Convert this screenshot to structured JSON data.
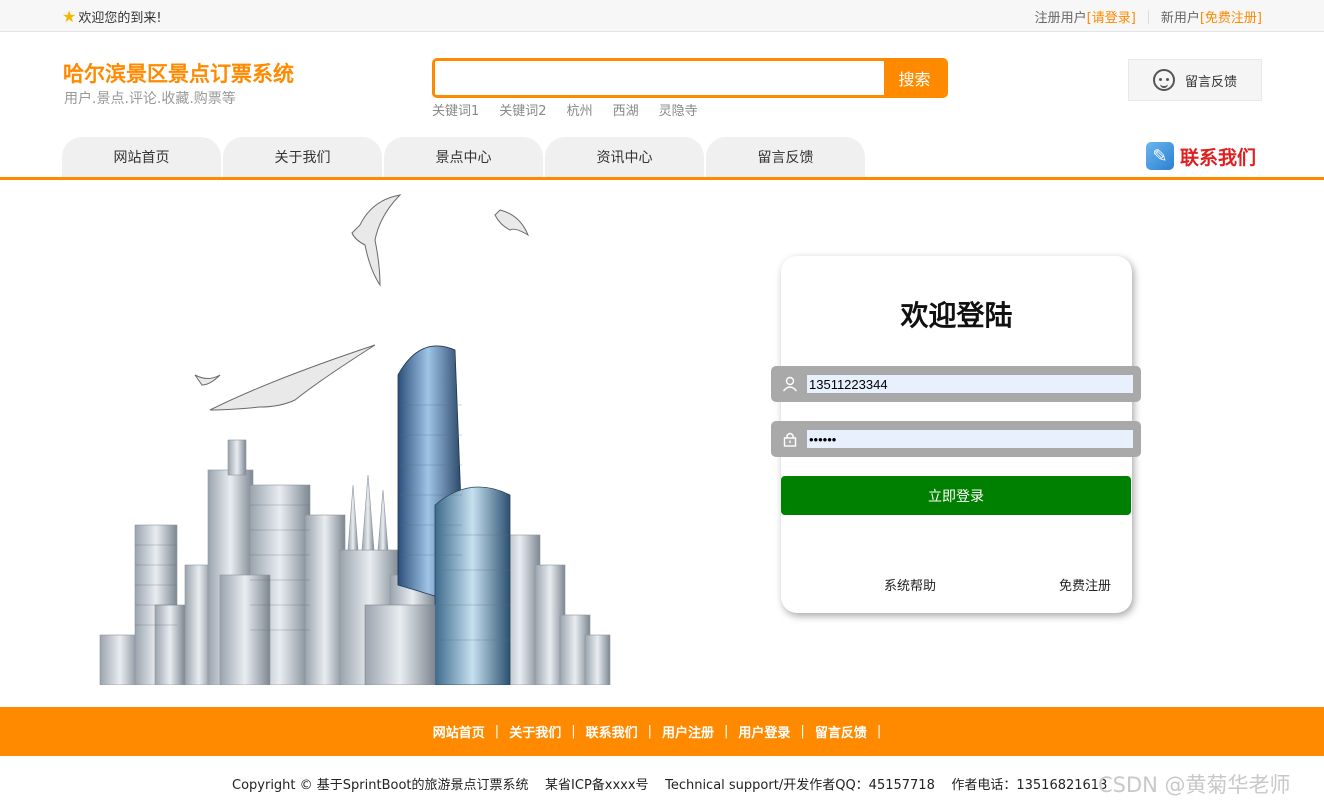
{
  "topbar": {
    "welcome": "欢迎您的到来!",
    "register_prefix": "注册用户",
    "login_link": "[请登录]",
    "new_user_prefix": "新用户",
    "free_register_link": "[免费注册]"
  },
  "header": {
    "title": "哈尔滨景区景点订票系统",
    "subtitle": "用户.景点.评论.收藏.购票等",
    "search": {
      "value": "",
      "button": "搜索"
    },
    "hot_words": [
      "关键词1",
      "关键词2",
      "杭州",
      "西湖",
      "灵隐寺"
    ],
    "feedback": "留言反馈"
  },
  "nav": {
    "items": [
      "网站首页",
      "关于我们",
      "景点中心",
      "资讯中心",
      "留言反馈"
    ],
    "contact": "联系我们"
  },
  "login": {
    "title": "欢迎登陆",
    "username": "13511223344",
    "password": "••••••",
    "button": "立即登录",
    "help": "系统帮助",
    "register": "免费注册"
  },
  "footer": {
    "links": [
      "网站首页",
      "关于我们",
      "联系我们",
      "用户注册",
      "用户登录",
      "留言反馈"
    ],
    "copyright": "Copyright © 基于SprintBoot的旅游景点订票系统    某省ICP备xxxx号    Technical support/开发作者QQ：45157718    作者电话：13516821613",
    "watermark": "CSDN @黄菊华老师"
  },
  "colors": {
    "accent": "#ff8a00",
    "login_button": "#008000",
    "contact": "#e02020"
  }
}
